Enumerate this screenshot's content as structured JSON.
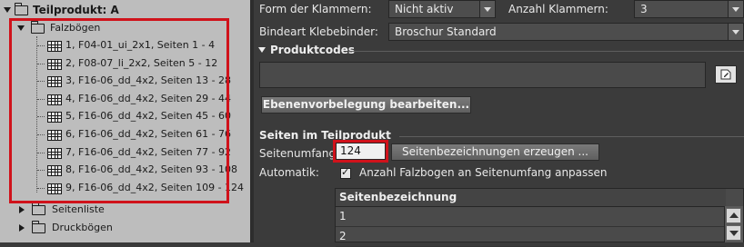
{
  "tree": {
    "root_label": "Teilprodukt: A",
    "folder_label": "Falzbögen",
    "sheets": [
      "1, F04-01_ui_2x1, Seiten 1 - 4",
      "2, F08-07_li_2x2, Seiten 5 - 12",
      "3, F16-06_dd_4x2, Seiten 13 - 28",
      "4, F16-06_dd_4x2, Seiten 29 - 44",
      "5, F16-06_dd_4x2, Seiten 45 - 60",
      "6, F16-06_dd_4x2, Seiten 61 - 76",
      "7, F16-06_dd_4x2, Seiten 77 - 92",
      "8, F16-06_dd_4x2, Seiten 93 - 108",
      "9, F16-06_dd_4x2, Seiten 109 - 124"
    ],
    "seitenliste_label": "Seitenliste",
    "druckboegen_label": "Druckbögen"
  },
  "form": {
    "form_klammern_label": "Form der Klammern:",
    "form_klammern_value": "Nicht aktiv",
    "anzahl_klammern_label": "Anzahl Klammern:",
    "anzahl_klammern_value": "3",
    "bindeart_label": "Bindeart Klebebinder:",
    "bindeart_value": "Broschur Standard"
  },
  "produktcodes": {
    "title": "Produktcodes",
    "edit_button": "Ebenenvorbelegung bearbeiten..."
  },
  "seiten": {
    "title": "Seiten im Teilprodukt",
    "seitenumfang_label": "Seitenumfang:",
    "seitenumfang_value": "124",
    "generate_button": "Seitenbezeichnungen erzeugen ...",
    "automatik_label": "Automatik:",
    "automatik_checkbox_label": "Anzahl Falzbogen an Seitenumfang anpassen",
    "table_header": "Seitenbezeichnung",
    "rows": [
      "1",
      "2"
    ]
  }
}
